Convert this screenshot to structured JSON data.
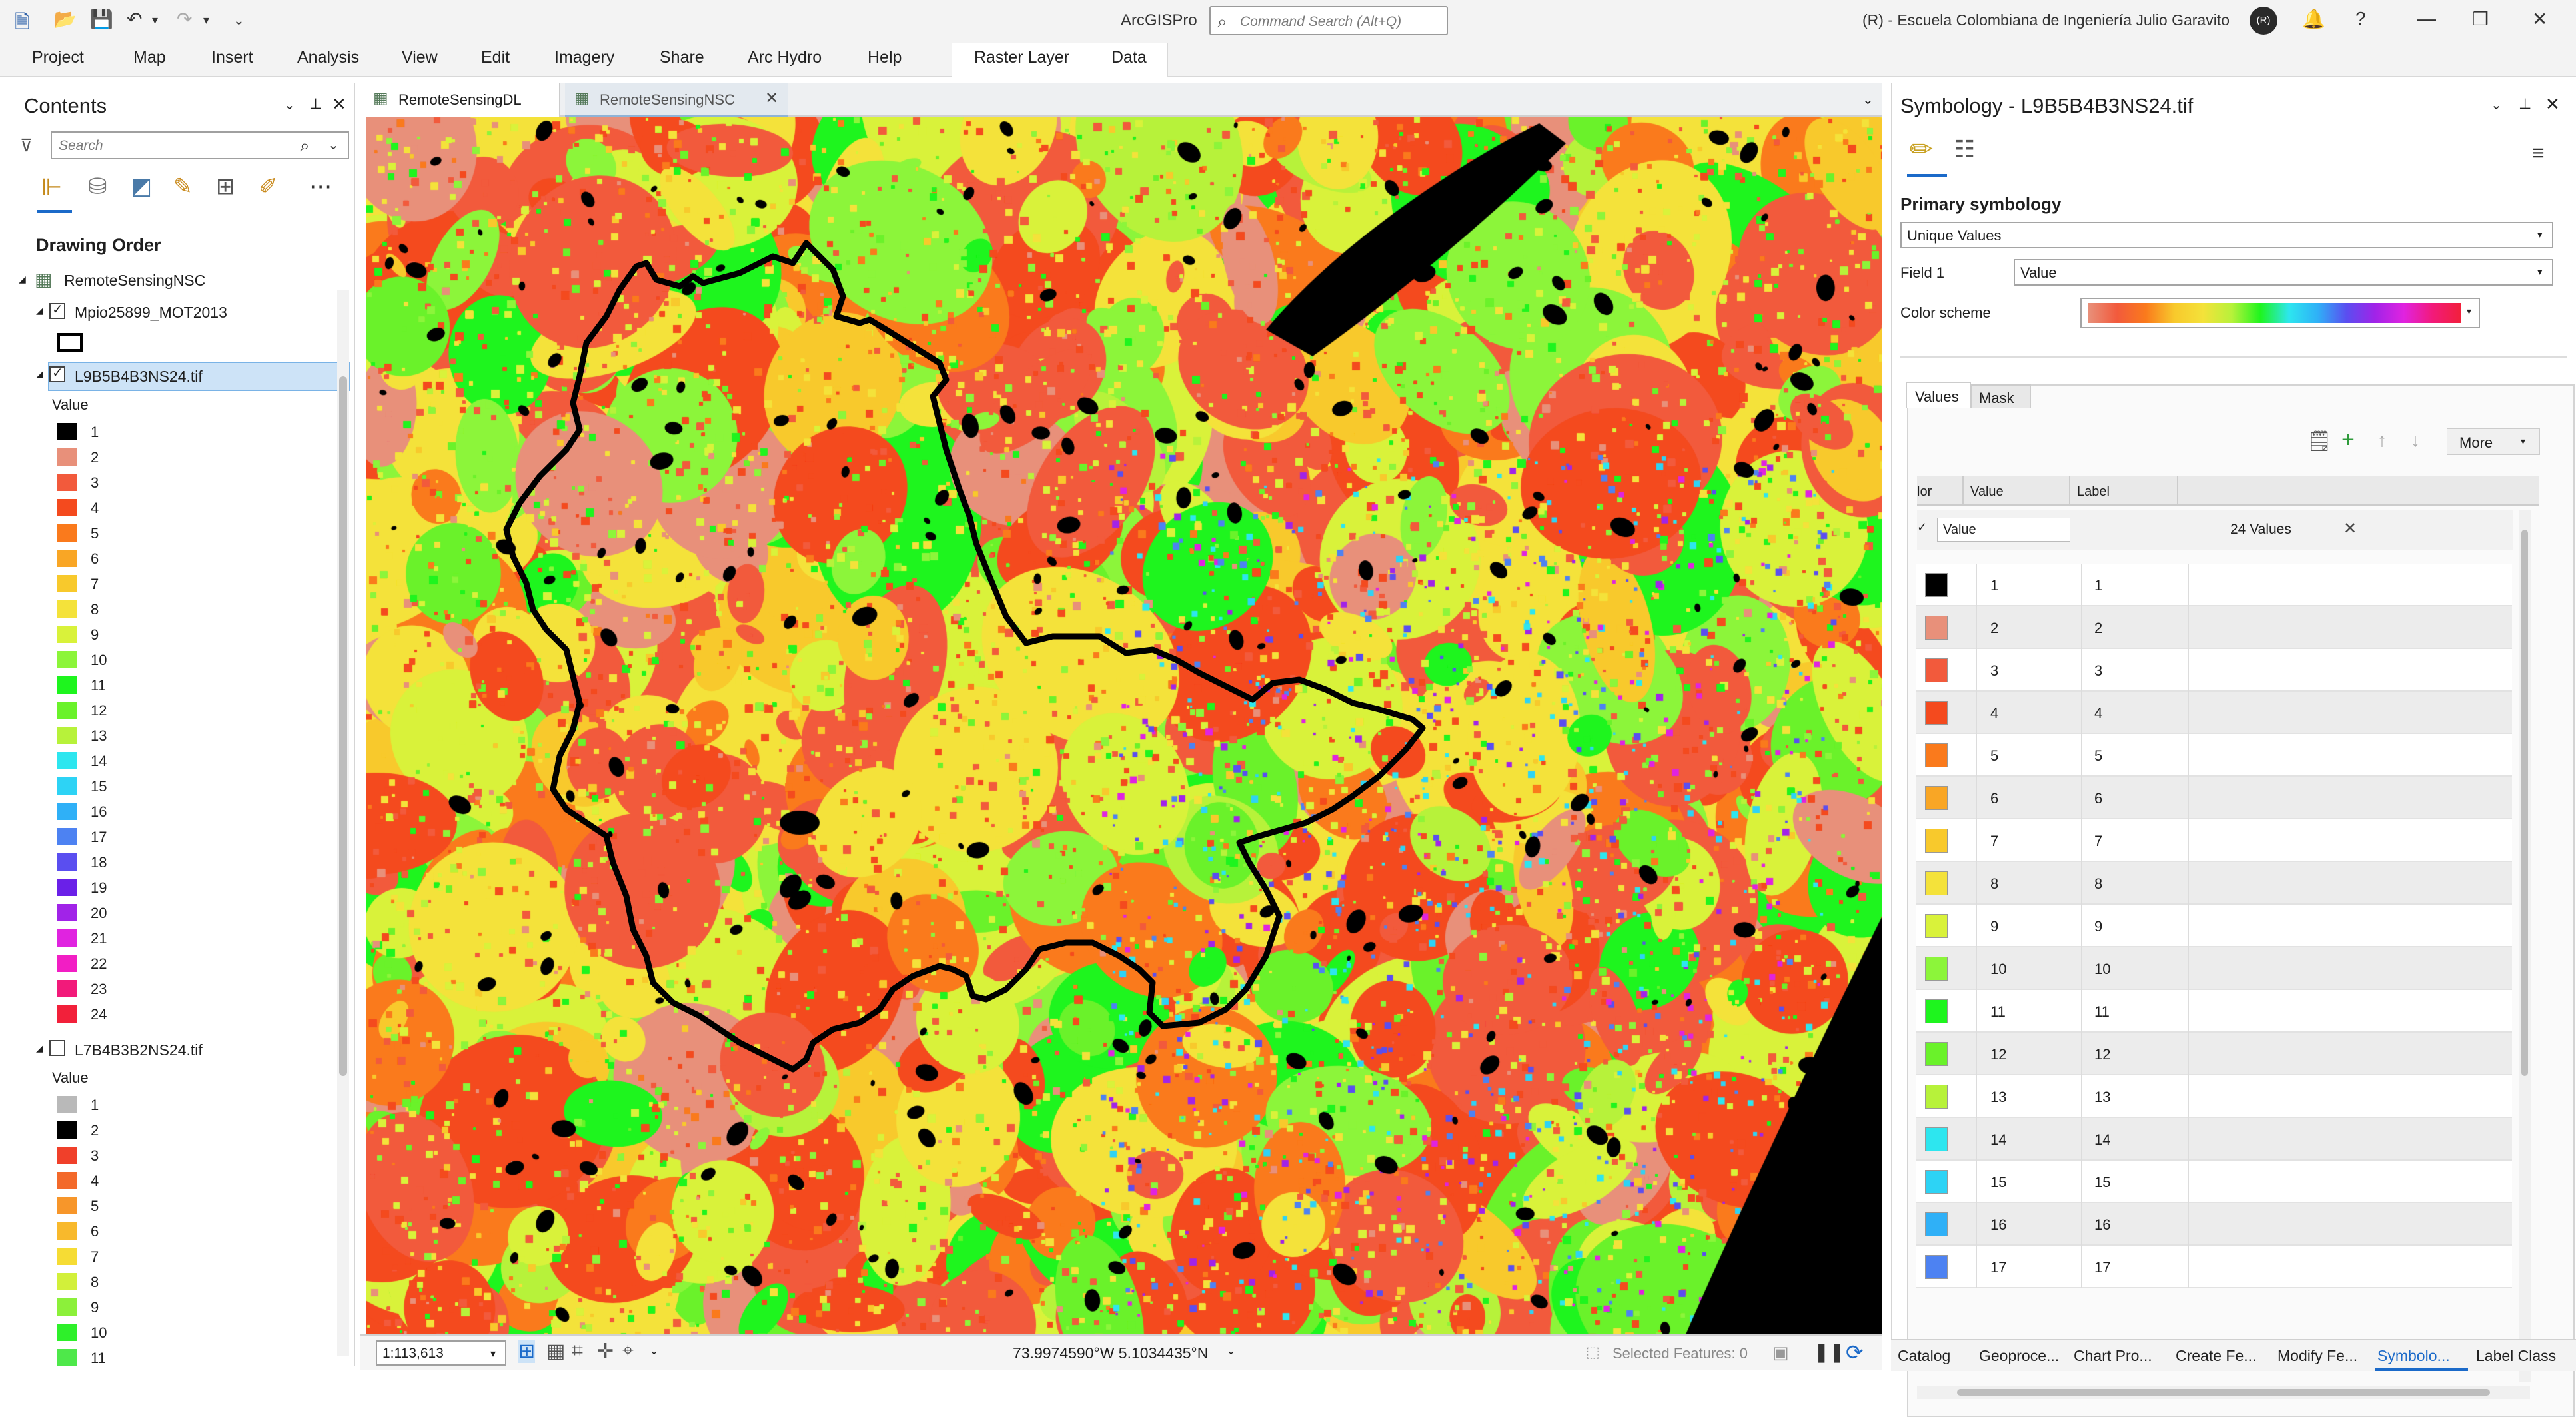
{
  "app": {
    "title": "ArcGISPro",
    "search_placeholder": "Command Search (Alt+Q)",
    "user_org": "(R) - Escuela Colombiana de Ingeniería Julio Garavito",
    "avatar": "(R)"
  },
  "ribbon": {
    "tabs": [
      "Project",
      "Map",
      "Insert",
      "Analysis",
      "View",
      "Edit",
      "Imagery",
      "Share",
      "Arc Hydro",
      "Help"
    ],
    "contextual": [
      "Raster Layer",
      "Data"
    ]
  },
  "contents": {
    "title": "Contents",
    "search_placeholder": "Search",
    "drawing_order": "Drawing Order",
    "map_name": "RemoteSensingNSC",
    "layer1": "Mpio25899_MOT2013",
    "layer2": "L9B5B4B3NS24.tif",
    "layer3": "L7B4B3B2NS24.tif",
    "value_heading": "Value",
    "legend1": [
      {
        "v": "1",
        "c": "#000000"
      },
      {
        "v": "2",
        "c": "#e8907a"
      },
      {
        "v": "3",
        "c": "#f25a3c"
      },
      {
        "v": "4",
        "c": "#f44a1e"
      },
      {
        "v": "5",
        "c": "#fa7a1c"
      },
      {
        "v": "6",
        "c": "#f9a625"
      },
      {
        "v": "7",
        "c": "#f8c92c"
      },
      {
        "v": "8",
        "c": "#f4e23a"
      },
      {
        "v": "9",
        "c": "#d9f23a"
      },
      {
        "v": "10",
        "c": "#8cf53a"
      },
      {
        "v": "11",
        "c": "#1ef51e"
      },
      {
        "v": "12",
        "c": "#6af22a"
      },
      {
        "v": "13",
        "c": "#b7f23a"
      },
      {
        "v": "14",
        "c": "#2de6ef"
      },
      {
        "v": "15",
        "c": "#2dd3f5"
      },
      {
        "v": "16",
        "c": "#2fb0f7"
      },
      {
        "v": "17",
        "c": "#4d82f2"
      },
      {
        "v": "18",
        "c": "#5a4ef0"
      },
      {
        "v": "19",
        "c": "#6a20e8"
      },
      {
        "v": "20",
        "c": "#a123e8"
      },
      {
        "v": "21",
        "c": "#e023e0"
      },
      {
        "v": "22",
        "c": "#f21ec4"
      },
      {
        "v": "23",
        "c": "#f21a7a"
      },
      {
        "v": "24",
        "c": "#f2203a"
      }
    ],
    "legend2": [
      {
        "v": "1",
        "c": "#b9b9b9"
      },
      {
        "v": "2",
        "c": "#000000"
      },
      {
        "v": "3",
        "c": "#f0402a"
      },
      {
        "v": "4",
        "c": "#f3692a"
      },
      {
        "v": "5",
        "c": "#f7962a"
      },
      {
        "v": "6",
        "c": "#f8b92c"
      },
      {
        "v": "7",
        "c": "#f6dc34"
      },
      {
        "v": "8",
        "c": "#d2f03a"
      },
      {
        "v": "9",
        "c": "#8cf03a"
      },
      {
        "v": "10",
        "c": "#2ef02a"
      },
      {
        "v": "11",
        "c": "#4ee84a"
      }
    ]
  },
  "map": {
    "tabs": [
      "RemoteSensingDL",
      "RemoteSensingNSC"
    ],
    "scale": "1:113,613",
    "coords": "73.9974590°W 5.1034435°N",
    "selected": "Selected Features: 0"
  },
  "symbology": {
    "title": "Symbology - L9B5B4B3NS24.tif",
    "primary": "Primary symbology",
    "renderer": "Unique Values",
    "field_label": "Field 1",
    "field_value": "Value",
    "scheme_label": "Color scheme",
    "subtabs": [
      "Values",
      "Mask"
    ],
    "more": "More",
    "col_color": "lor",
    "col_value": "Value",
    "col_label": "Label",
    "group_field": "Value",
    "group_count": "24 Values",
    "rows": [
      {
        "v": "1",
        "l": "1",
        "c": "#000000"
      },
      {
        "v": "2",
        "l": "2",
        "c": "#e8907a"
      },
      {
        "v": "3",
        "l": "3",
        "c": "#f25a3c"
      },
      {
        "v": "4",
        "l": "4",
        "c": "#f44a1e"
      },
      {
        "v": "5",
        "l": "5",
        "c": "#fa7a1c"
      },
      {
        "v": "6",
        "l": "6",
        "c": "#f9a625"
      },
      {
        "v": "7",
        "l": "7",
        "c": "#f8c92c"
      },
      {
        "v": "8",
        "l": "8",
        "c": "#f4e23a"
      },
      {
        "v": "9",
        "l": "9",
        "c": "#d9f23a"
      },
      {
        "v": "10",
        "l": "10",
        "c": "#8cf53a"
      },
      {
        "v": "11",
        "l": "11",
        "c": "#1ef51e"
      },
      {
        "v": "12",
        "l": "12",
        "c": "#6af22a"
      },
      {
        "v": "13",
        "l": "13",
        "c": "#b7f23a"
      },
      {
        "v": "14",
        "l": "14",
        "c": "#2de6ef"
      },
      {
        "v": "15",
        "l": "15",
        "c": "#2dd3f5"
      },
      {
        "v": "16",
        "l": "16",
        "c": "#2fb0f7"
      },
      {
        "v": "17",
        "l": "17",
        "c": "#4d82f2"
      }
    ]
  },
  "bottom_tabs": [
    "Catalog",
    "Geoproce...",
    "Chart Pro...",
    "Create Fe...",
    "Modify Fe...",
    "Symbolo...",
    "Label Class"
  ]
}
